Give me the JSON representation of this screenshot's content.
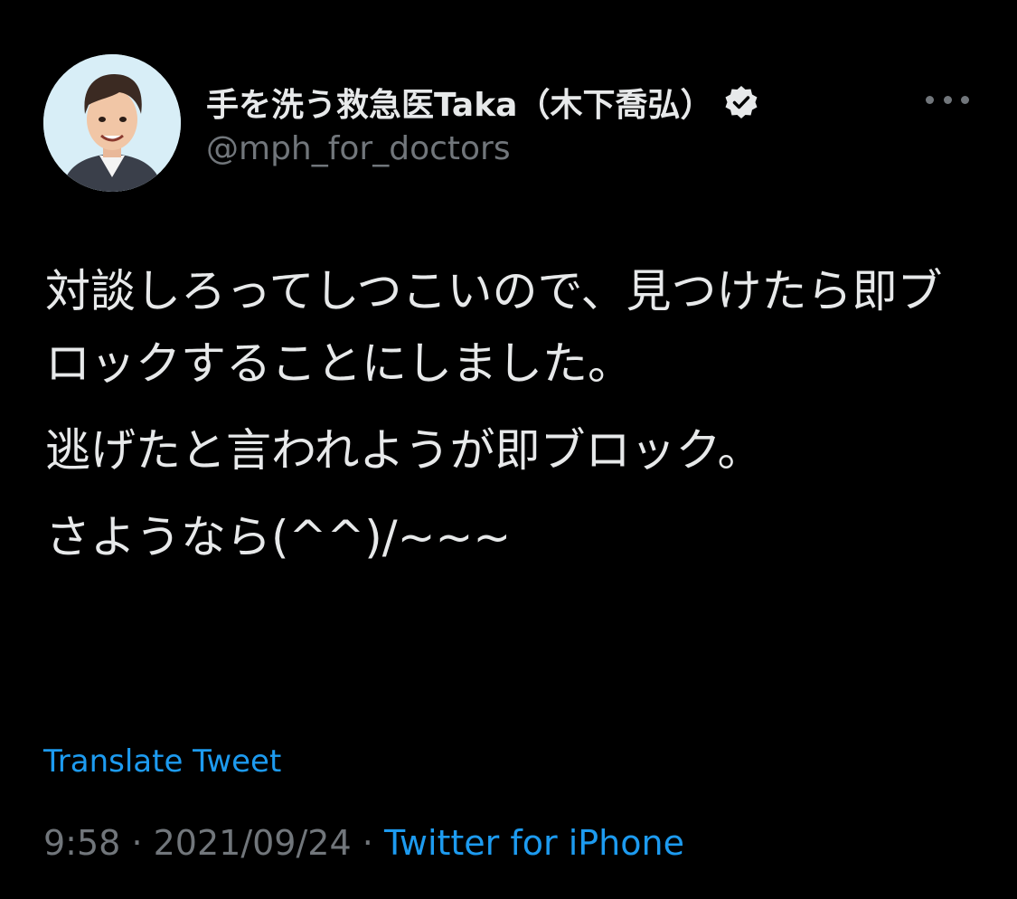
{
  "author": {
    "display_name": "手を洗う救急医Taka（木下喬弘）",
    "handle": "@mph_for_doctors",
    "verified": true,
    "avatar_icon": "avatar-illustration"
  },
  "tweet": {
    "paragraphs": [
      "対談しろってしつこいので、見つけたら即ブロックすることにしました。",
      "逃げたと言われようが即ブロック。",
      "さようなら(^^)/~~~"
    ],
    "translate_label": "Translate Tweet",
    "time": "9:58",
    "date": "2021/09/24",
    "separator": "·",
    "source": "Twitter for iPhone"
  },
  "icons": {
    "verified": "verified-badge-icon",
    "more": "more-options-icon"
  },
  "colors": {
    "background": "#000000",
    "text": "#e7e9ea",
    "secondary": "#71767b",
    "accent": "#1d9bf0"
  }
}
